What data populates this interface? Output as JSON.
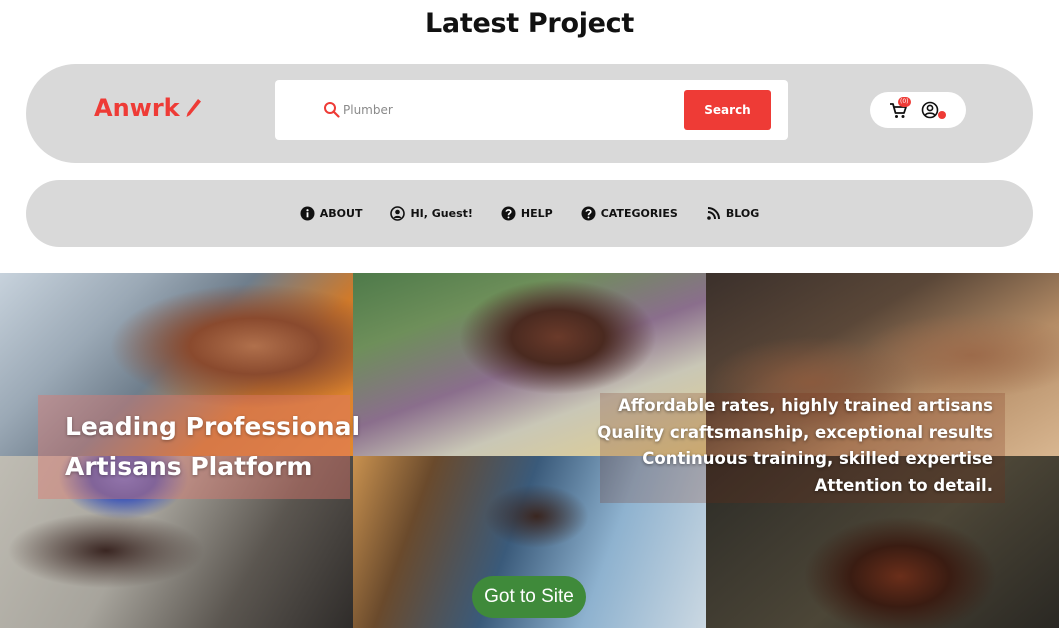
{
  "page": {
    "title": "Latest Project"
  },
  "header": {
    "logo_text": "Anwrk",
    "logo_icon": "pencil-icon",
    "search": {
      "placeholder": "Plumber",
      "value": "",
      "icon": "search-icon",
      "button_label": "Search"
    },
    "cart": {
      "icon": "cart-icon",
      "badge": "(0)"
    },
    "account": {
      "icon": "account-icon",
      "status": "notification-dot"
    }
  },
  "nav": {
    "items": [
      {
        "label": "ABOUT",
        "icon": "info-icon"
      },
      {
        "label": "HI, Guest!",
        "icon": "user-icon"
      },
      {
        "label": "HELP",
        "icon": "help-icon"
      },
      {
        "label": "CATEGORIES",
        "icon": "question-icon"
      },
      {
        "label": "BLOG",
        "icon": "rss-icon"
      }
    ]
  },
  "hero": {
    "title_lines": [
      "Leading Professional",
      "Artisans Platform"
    ],
    "points": [
      "Affordable rates, highly trained artisans",
      "Quality craftsmanship, exceptional results",
      "Continuous training, skilled expertise",
      "Attention to detail."
    ],
    "cta_label": "Got to Site"
  },
  "colors": {
    "brand_red": "#ee3b36",
    "bar_gray": "#d9d9d9",
    "cta_green": "#3f8a3a"
  }
}
